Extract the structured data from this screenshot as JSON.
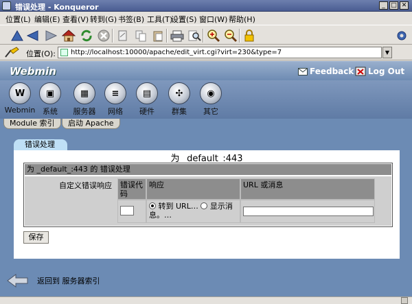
{
  "window": {
    "title": "错误处理 - Konqueror"
  },
  "menubar": {
    "items": [
      "位置(L)",
      "编辑(E)",
      "查看(V)",
      "转到(G)",
      "书签(B)",
      "工具(T)",
      "设置(S)",
      "窗口(W)",
      "帮助(H)"
    ]
  },
  "toolbar": {
    "buttons": [
      "up-icon",
      "back-icon",
      "forward-icon",
      "home-icon",
      "reload-icon",
      "stop-icon",
      "cut-icon",
      "copy-icon",
      "paste-icon",
      "print-icon",
      "find-icon",
      "zoom-in-icon",
      "zoom-out-icon",
      "lock-icon",
      "konqueror-gear-icon"
    ]
  },
  "location": {
    "label": "位置(O):",
    "url": "http://localhost:10000/apache/edit_virt.cgi?virt=230&type=7"
  },
  "webmin": {
    "logo": "Webmin",
    "feedback": "Feedback",
    "logout": "Log Out",
    "categories": [
      {
        "label": "Webmin",
        "icon": "webmin-icon"
      },
      {
        "label": "系统",
        "icon": "system-icon"
      },
      {
        "label": "服务器",
        "icon": "servers-icon"
      },
      {
        "label": "网络",
        "icon": "network-icon"
      },
      {
        "label": "硬件",
        "icon": "hardware-icon"
      },
      {
        "label": "群集",
        "icon": "cluster-icon"
      },
      {
        "label": "其它",
        "icon": "others-icon"
      }
    ],
    "module_tabs": [
      "Module 索引",
      "启动 Apache"
    ]
  },
  "section": {
    "tab": "错误处理",
    "title": "为 _default_:443",
    "box_header": "为 _default_:443 的 错误处理",
    "custom_label": "自定义错误响应",
    "columns": [
      "错误代码",
      "响应",
      "URL 或消息"
    ],
    "error_code_value": "",
    "response_options": [
      "转到 URL…",
      "显示消息。…"
    ],
    "response_selected": "转到 URL…",
    "url_value": "",
    "save_label": "保存"
  },
  "footer": {
    "back_text": "返回到 服务器索引"
  }
}
